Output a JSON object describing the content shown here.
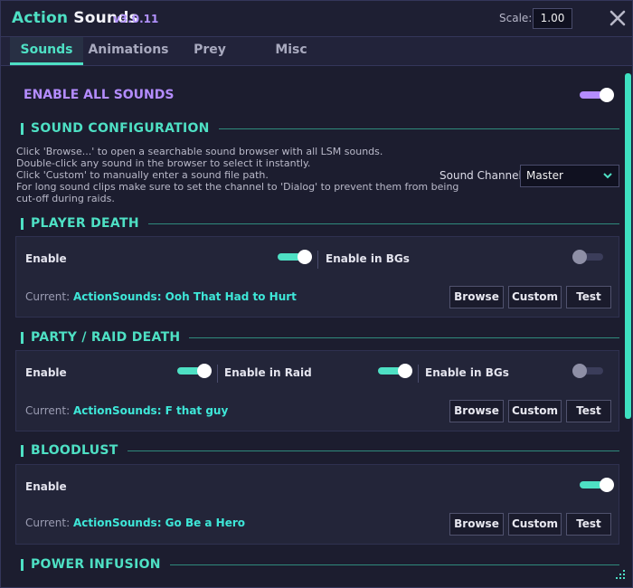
{
  "header": {
    "title_part1": "Action",
    "title_part2": "Sounds",
    "version": "v3.0.11",
    "scale_label": "Scale:",
    "scale_value": "1.00",
    "close_icon": "close-icon"
  },
  "tabs": [
    {
      "label": "Sounds",
      "active": true
    },
    {
      "label": "Animations",
      "active": false
    },
    {
      "label": "Prey",
      "active": false
    },
    {
      "label": "Misc",
      "active": false
    }
  ],
  "enable_all": {
    "label": "ENABLE ALL SOUNDS",
    "on": true
  },
  "sound_config": {
    "title": "SOUND CONFIGURATION",
    "description": [
      "Click 'Browse...' to open a searchable sound browser with all LSM sounds.",
      "Double-click any sound in the browser to select it instantly.",
      "Click 'Custom' to manually enter a sound file path.",
      "For long sound clips make sure to set the channel to 'Dialog' to prevent them from being",
      "cut-off during raids."
    ],
    "channel_label": "Sound Channel",
    "channel_value": "Master"
  },
  "sections": [
    {
      "title": "PLAYER DEATH",
      "enable_label": "Enable",
      "enable_on": true,
      "bg_label": "Enable in BGs",
      "bg_on": false,
      "current_label": "Current:",
      "current_value": "ActionSounds: Ooh That Had to Hurt"
    },
    {
      "title": "PARTY / RAID DEATH",
      "enable_label": "Enable",
      "enable_on": true,
      "raid_label": "Enable in Raid",
      "raid_on": true,
      "bg_label": "Enable in BGs",
      "bg_on": false,
      "current_label": "Current:",
      "current_value": "ActionSounds: F that guy"
    },
    {
      "title": "BLOODLUST",
      "enable_label": "Enable",
      "enable_on": true,
      "current_label": "Current:",
      "current_value": "ActionSounds: Go Be a Hero"
    },
    {
      "title": "POWER INFUSION"
    }
  ],
  "buttons": {
    "browse": "Browse",
    "custom": "Custom",
    "test": "Test"
  },
  "colors": {
    "accent": "#4ee0c4",
    "purple": "#b48cff",
    "background": "#1c1d2f",
    "panel": "#232539",
    "value_text": "#3ee7d8"
  }
}
